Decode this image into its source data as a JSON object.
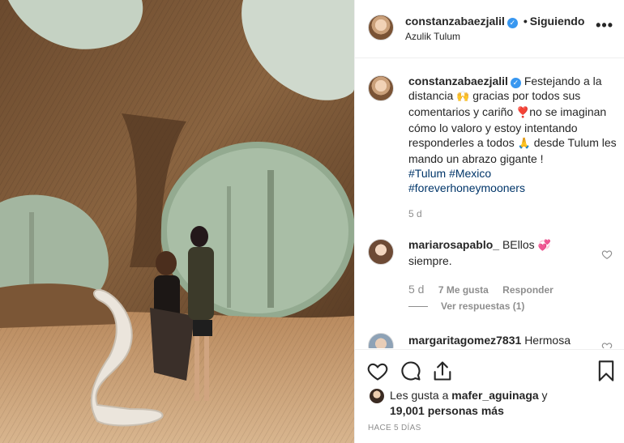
{
  "post": {
    "username": "constanzabaezjalil",
    "follow_separator": "•",
    "follow_status": "Siguiendo",
    "location": "Azulik Tulum",
    "more_icon": "more-options-icon"
  },
  "caption": {
    "username": "constanzabaezjalil",
    "part1": "Festejando a la distancia ",
    "emoji1": "🙌",
    "part2": " gracias por todos sus comentarios y cariño ",
    "emoji2": "❣️",
    "part3": "no se imaginan cómo lo valoro y estoy intentando responderles a todos ",
    "emoji3": "🙏",
    "part4": " desde Tulum les mando un abrazo gigante !",
    "tag1": "#Tulum",
    "tag2": "#Mexico",
    "tag3": "#foreverhoneymooners",
    "age": "5 d"
  },
  "comments": [
    {
      "username": "mariarosapablo_",
      "text": "BEllos ",
      "emoji": "💞",
      "text2": " siempre.",
      "age": "5 d",
      "likes": "7 Me gusta",
      "reply": "Responder",
      "view_replies": "Ver respuestas (1)"
    },
    {
      "username": "margaritagomez7831",
      "text": "Hermosa"
    }
  ],
  "actions": {
    "likes_prefix": "Les gusta a ",
    "likes_user": "mafer_aguinaga",
    "likes_mid": " y",
    "likes_count": "19,001 personas más",
    "time": "HACE 5 DÍAS"
  },
  "colors": {
    "link": "#003569",
    "verified": "#3897f0",
    "muted": "#8e8e8e",
    "heart": "#ed4956"
  }
}
